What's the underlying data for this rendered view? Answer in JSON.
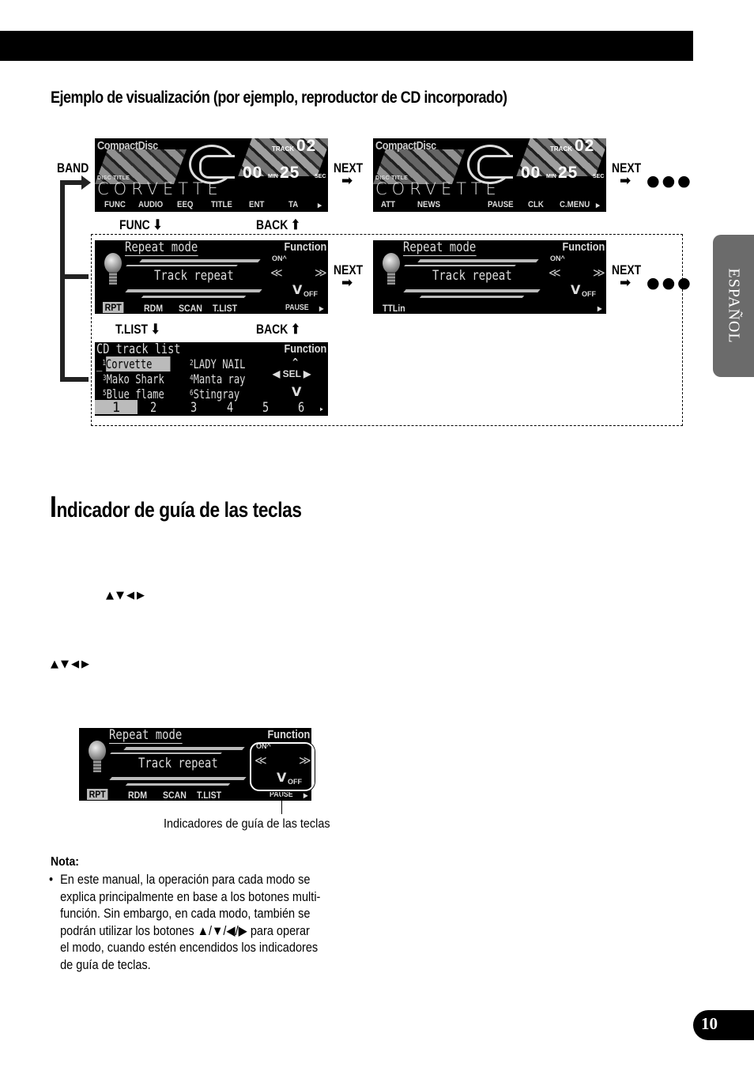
{
  "header": {
    "section_heading": "Ejemplo de visualización (por ejemplo, reproductor de CD incorporado)"
  },
  "side_tab": {
    "label": "ESPAÑOL"
  },
  "diagram": {
    "labels": {
      "band": "BAND",
      "next": "NEXT",
      "func": "FUNC",
      "back": "BACK",
      "tlist": "T.LIST",
      "arrow_right": "➡",
      "arrow_down": "⬇",
      "arrow_up": "⬆",
      "ellipsis": "●●●"
    },
    "main_screens": [
      {
        "brand": "CompactDisc",
        "track_label": "TRACK",
        "track_number": "02",
        "time_min": "00",
        "min_label": "MIN",
        "time_sec": "25",
        "sec_label": "SEC",
        "disc_title_label": "DISC TITLE",
        "disc_title": "CORVETTE",
        "menu": [
          "FUNC",
          "AUDIO",
          "EEQ",
          "TITLE",
          "ENT",
          "TA",
          "▸"
        ]
      },
      {
        "brand": "CompactDisc",
        "track_label": "TRACK",
        "track_number": "02",
        "time_min": "00",
        "min_label": "MIN",
        "time_sec": "25",
        "sec_label": "SEC",
        "disc_title_label": "DISC TITLE",
        "disc_title": "CORVETTE",
        "menu": [
          "ATT",
          "NEWS",
          "PAUSE",
          "CLK",
          "C.MENU",
          "▸"
        ]
      }
    ],
    "function_screens": [
      {
        "title": "Repeat mode",
        "value": "Track repeat",
        "function_label": "Function",
        "on_label": "ON",
        "off_label": "OFF",
        "left_arrow": "≪",
        "right_arrow": "≫",
        "up_arrow": "^",
        "down_arrow": "V",
        "menu": [
          "RPT",
          "RDM",
          "SCAN",
          "T.LIST",
          "PAUSE",
          "▸"
        ],
        "selected_menu": "RPT"
      },
      {
        "title": "Repeat mode",
        "value": "Track repeat",
        "function_label": "Function",
        "on_label": "ON",
        "off_label": "OFF",
        "left_arrow": "≪",
        "right_arrow": "≫",
        "up_arrow": "^",
        "down_arrow": "V",
        "menu": [
          "TTLin",
          "▸"
        ]
      }
    ],
    "track_list_screen": {
      "title": "CD track list",
      "function_label": "Function",
      "sel_label": "◀ SEL ▶",
      "up_arrow": "^",
      "down_arrow": "V",
      "tracks": [
        {
          "num": "1",
          "name": "Corvette",
          "selected": true
        },
        {
          "num": "2",
          "name": "LADY NAIL"
        },
        {
          "num": "3",
          "name": "Mako Shark"
        },
        {
          "num": "4",
          "name": "Manta ray"
        },
        {
          "num": "5",
          "name": "Blue flame"
        },
        {
          "num": "6",
          "name": "Stingray"
        }
      ],
      "pages": [
        "1",
        "2",
        "3",
        "4",
        "5",
        "6",
        "▸"
      ],
      "current_page": "1"
    }
  },
  "guide_section": {
    "heading_cap": "I",
    "heading_rest": "ndicador de guía de las teclas",
    "key_glyphs": "▲▼◀▶",
    "example_screen": {
      "title": "Repeat mode",
      "value": "Track repeat",
      "function_label": "Function",
      "on_label": "ON",
      "off_label": "OFF",
      "left_arrow": "≪",
      "right_arrow": "≫",
      "up_arrow": "^",
      "down_arrow": "V",
      "menu": [
        "RPT",
        "RDM",
        "SCAN",
        "T.LIST",
        "PAUSE",
        "▸"
      ]
    },
    "caption": "Indicadores de guía de las teclas"
  },
  "note": {
    "title": "Nota:",
    "bullet": "•",
    "lines": [
      "En este manual, la operación para cada modo se",
      "explica principalmente en base a los botones multi-",
      "función. Sin embargo, en cada modo, también se",
      "podrán utilizar los botones ▲/▼/◀/▶ para operar",
      "el modo, cuando estén encendidos los indicadores",
      "de guía de teclas."
    ]
  },
  "page_number": "10"
}
